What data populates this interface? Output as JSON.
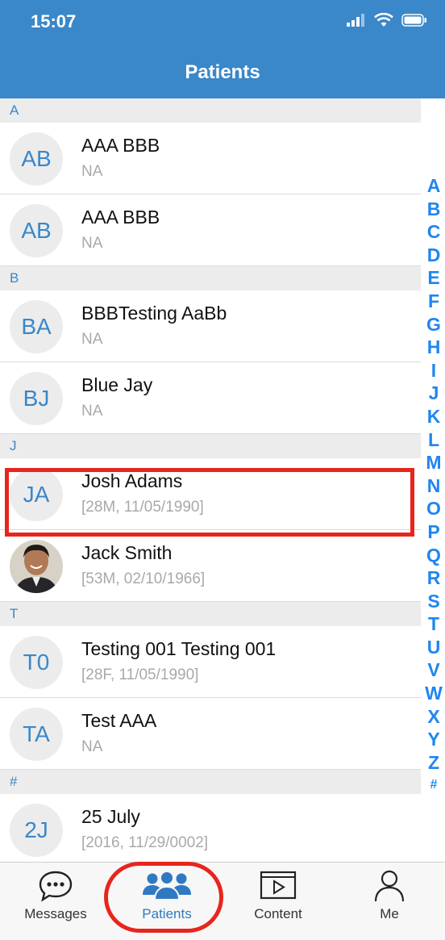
{
  "status_bar": {
    "time": "15:07"
  },
  "header": {
    "title": "Patients"
  },
  "list": [
    {
      "section": "A"
    },
    {
      "initials": "AB",
      "name": "AAA BBB",
      "detail": "NA"
    },
    {
      "initials": "AB",
      "name": "AAA BBB",
      "detail": "NA"
    },
    {
      "section": "B"
    },
    {
      "initials": "BA",
      "name": "BBBTesting AaBb",
      "detail": "NA"
    },
    {
      "initials": "BJ",
      "name": "Blue Jay",
      "detail": "NA"
    },
    {
      "section": "J"
    },
    {
      "initials": "JA",
      "name": "Josh Adams",
      "detail": "[28M, 11/05/1990]"
    },
    {
      "initials": "",
      "photo": true,
      "name": "Jack Smith",
      "detail": "[53M, 02/10/1966]"
    },
    {
      "section": "T"
    },
    {
      "initials": "T0",
      "name": "Testing 001 Testing 001",
      "detail": "[28F, 11/05/1990]"
    },
    {
      "initials": "TA",
      "name": "Test AAA",
      "detail": "NA"
    },
    {
      "section": "#"
    },
    {
      "initials": "2J",
      "name": "25 July",
      "detail": "[2016, 11/29/0002]"
    }
  ],
  "index_letters": [
    "A",
    "B",
    "C",
    "D",
    "E",
    "F",
    "G",
    "H",
    "I",
    "J",
    "K",
    "L",
    "M",
    "N",
    "O",
    "P",
    "Q",
    "R",
    "S",
    "T",
    "U",
    "V",
    "W",
    "X",
    "Y",
    "Z",
    "#"
  ],
  "tabs": [
    {
      "label": "Messages",
      "icon": "chat-bubble-icon",
      "active": false
    },
    {
      "label": "Patients",
      "icon": "people-group-icon",
      "active": true
    },
    {
      "label": "Content",
      "icon": "video-play-icon",
      "active": false
    },
    {
      "label": "Me",
      "icon": "person-icon",
      "active": false
    }
  ],
  "colors": {
    "primary": "#3a87c9",
    "index": "#1f86f0",
    "highlight": "#e8251d"
  }
}
